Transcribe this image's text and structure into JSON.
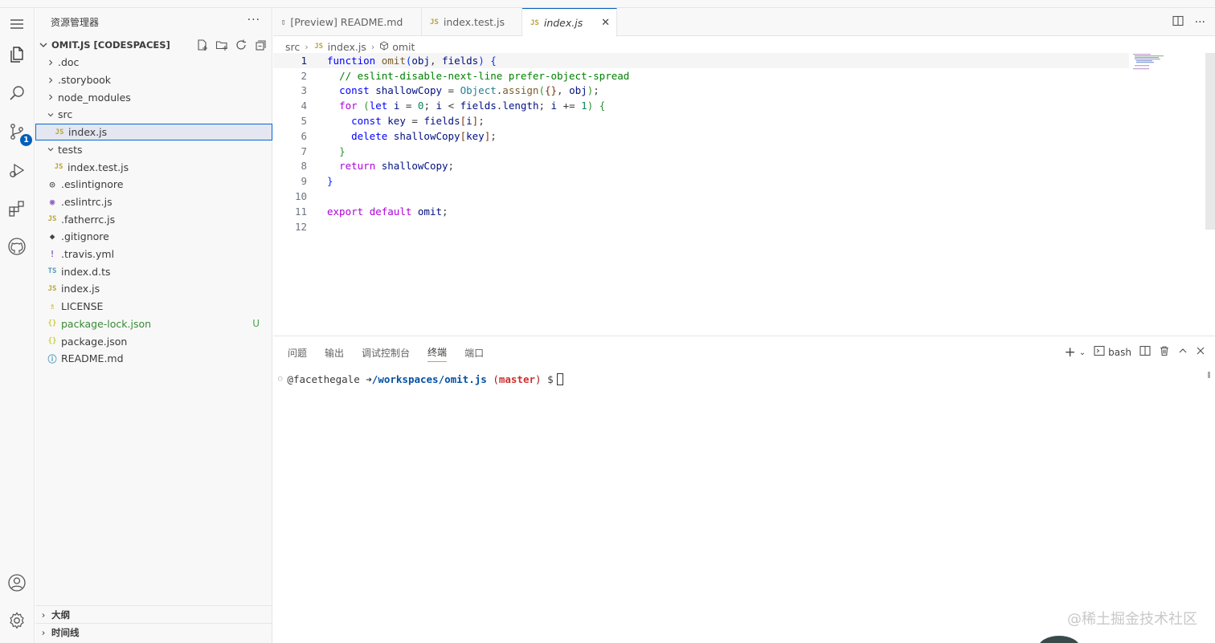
{
  "sidebar": {
    "title": "资源管理器",
    "more": "···",
    "section": "OMIT.JS [CODESPACES]",
    "tree": [
      {
        "label": ".doc",
        "twisty": ">",
        "icon": "",
        "indent": 1
      },
      {
        "label": ".storybook",
        "twisty": ">",
        "icon": "",
        "indent": 1
      },
      {
        "label": "node_modules",
        "twisty": ">",
        "icon": "",
        "indent": 1
      },
      {
        "label": "src",
        "twisty": "v",
        "icon": "",
        "indent": 1
      },
      {
        "label": "index.js",
        "twisty": "",
        "icon": "JS",
        "indent": 2,
        "selected": true
      },
      {
        "label": "tests",
        "twisty": "v",
        "icon": "",
        "indent": 1
      },
      {
        "label": "index.test.js",
        "twisty": "",
        "icon": "JS",
        "indent": 2
      },
      {
        "label": ".eslintignore",
        "twisty": "",
        "icon": "◎",
        "indent": 1
      },
      {
        "label": ".eslintrc.js",
        "twisty": "",
        "icon": "◉",
        "indent": 1
      },
      {
        "label": ".fatherrc.js",
        "twisty": "",
        "icon": "JS",
        "indent": 1
      },
      {
        "label": ".gitignore",
        "twisty": "",
        "icon": "◆",
        "indent": 1
      },
      {
        "label": ".travis.yml",
        "twisty": "",
        "icon": "!",
        "indent": 1
      },
      {
        "label": "index.d.ts",
        "twisty": "",
        "icon": "TS",
        "indent": 1
      },
      {
        "label": "index.js",
        "twisty": "",
        "icon": "JS",
        "indent": 1
      },
      {
        "label": "LICENSE",
        "twisty": "",
        "icon": "♗",
        "indent": 1
      },
      {
        "label": "package-lock.json",
        "twisty": "",
        "icon": "{}",
        "indent": 1,
        "status": "U"
      },
      {
        "label": "package.json",
        "twisty": "",
        "icon": "{}",
        "indent": 1
      },
      {
        "label": "README.md",
        "twisty": "",
        "icon": "ⓘ",
        "indent": 1
      }
    ],
    "outline": "大纲",
    "timeline": "时间线"
  },
  "activity": {
    "scm_badge": "1"
  },
  "tabs": [
    {
      "label": "[Preview] README.md",
      "icon": "▯"
    },
    {
      "label": "index.test.js",
      "icon": "JS"
    },
    {
      "label": "index.js",
      "icon": "JS",
      "active": true,
      "close": "✕"
    }
  ],
  "breadcrumb": {
    "folder": "src",
    "file": "index.js",
    "symbol": "omit"
  },
  "panel": {
    "tabs": [
      "问题",
      "输出",
      "调试控制台",
      "终端",
      "端口"
    ],
    "active_tab": "终端",
    "shell": "bash",
    "terminal": {
      "user": "@facethegale",
      "arrow": "➜",
      "path": "/workspaces/omit.js",
      "branch": "master",
      "prompt": "$"
    }
  },
  "watermark": "@稀土掘金技术社区"
}
